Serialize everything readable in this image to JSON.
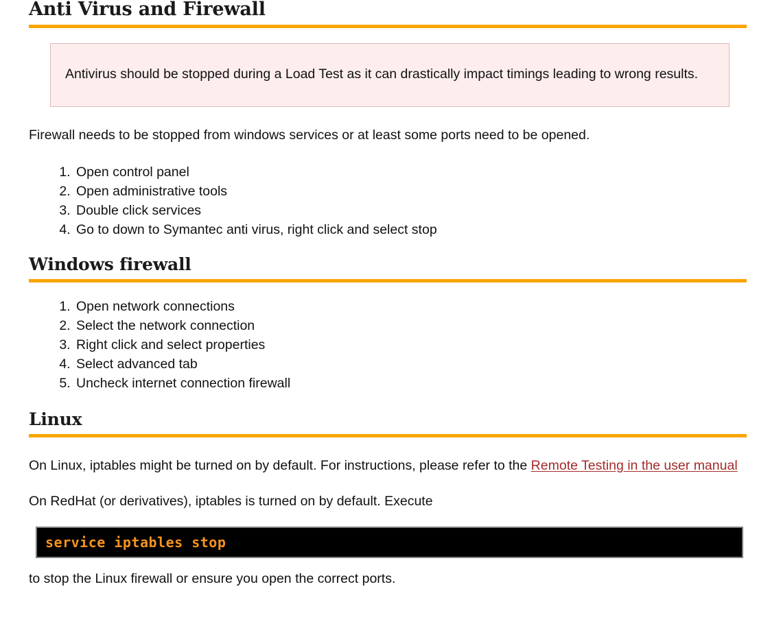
{
  "page": {
    "accent_color": "#f9a503",
    "link_color": "#a52a2a",
    "alert_background": "#fdeded",
    "alert_border": "#dbbcbc",
    "code_background": "#000000",
    "code_text_color": "#f7941e",
    "code_border": "#808080"
  },
  "sections": {
    "antivirus": {
      "heading": "Anti Virus and Firewall",
      "alert": "Antivirus should be stopped during a Load Test as it can drastically impact timings leading to wrong results.",
      "intro": "Firewall needs to be stopped from windows services or at least some ports need to be opened.",
      "steps": [
        "Open control panel",
        "Open administrative tools",
        "Double click services",
        "Go to down to Symantec anti virus, right click and select stop"
      ]
    },
    "windows_firewall": {
      "heading": "Windows firewall",
      "steps": [
        "Open network connections",
        "Select the network connection",
        "Right click and select properties",
        "Select advanced tab",
        "Uncheck internet connection firewall"
      ]
    },
    "linux": {
      "heading": "Linux",
      "para1_before_link": "On Linux, iptables might be turned on by default. For instructions, please refer to the ",
      "para1_link": "Remote Testing in the user manual",
      "para2": "On RedHat (or derivatives), iptables is turned on by default. Execute",
      "code": "service iptables stop",
      "para3": "to stop the Linux firewall or ensure you open the correct ports."
    }
  }
}
